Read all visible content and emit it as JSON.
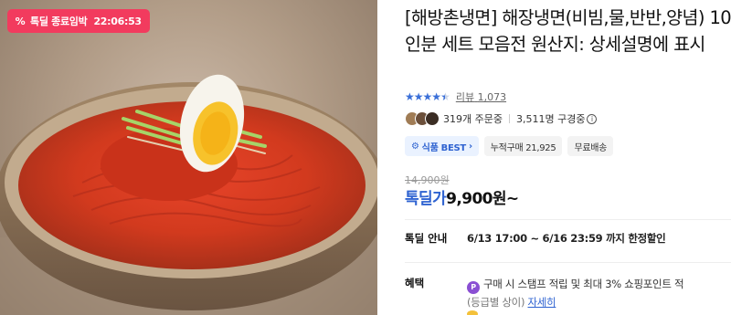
{
  "badge": {
    "icon": "percent-tag-icon",
    "label": "톡딜 종료임박",
    "timer": "22:06:53"
  },
  "product": {
    "title": "[해방촌냉면] 해장냉면(비빔,물,반반,양념) 10인분 세트 모음전 원산지: 상세설명에 표시"
  },
  "rating": {
    "stars": 4.5,
    "review_label": "리뷰",
    "review_count": "1,073",
    "star_color": "#3a6fd8"
  },
  "social": {
    "orders": "319개 주문중",
    "subscribers": "3,511명 구경중"
  },
  "tags": [
    {
      "label": "식품 BEST",
      "icon": "gear-icon",
      "highlight": true
    },
    {
      "label": "누적구매 21,925",
      "highlight": false
    },
    {
      "label": "무료배송",
      "highlight": false
    }
  ],
  "price": {
    "original": "14,900원",
    "deal_label": "톡딜가",
    "deal_value": "9,900원~",
    "accent": "#2f63d1"
  },
  "deal_info": {
    "label": "톡딜 안내",
    "value": "6/13 17:00 ~ 6/16 23:59 까지 한정할인"
  },
  "benefit": {
    "label": "혜택",
    "icon": "point-icon",
    "line1": "구매 시 스탬프 적립 및 최대 3% 쇼핑포인트 적",
    "line2_prefix": "(등급별 상이)",
    "line2_link": "자세히"
  },
  "colors": {
    "badge_bg": "#f23b5e",
    "best_tag_bg": "#eaf2ff"
  }
}
